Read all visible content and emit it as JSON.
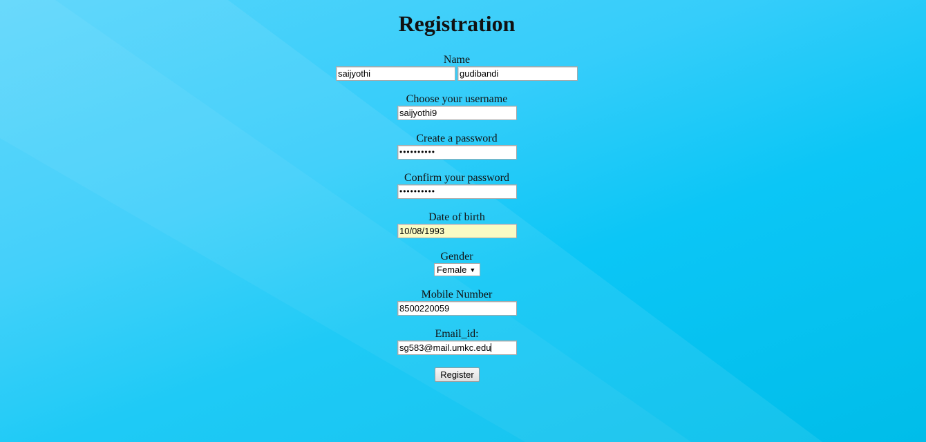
{
  "form": {
    "title": "Registration",
    "name": {
      "label": "Name",
      "first_value": "saijyothi",
      "last_value": "gudibandi"
    },
    "username": {
      "label": "Choose your username",
      "value": "saijyothi9"
    },
    "password": {
      "label": "Create a password",
      "masked_value": "••••••••••"
    },
    "confirm_password": {
      "label": "Confirm your password",
      "masked_value": "••••••••••"
    },
    "dob": {
      "label": "Date of birth",
      "value": "10/08/1993"
    },
    "gender": {
      "label": "Gender",
      "selected": "Female"
    },
    "mobile": {
      "label": "Mobile Number",
      "value": "8500220059"
    },
    "email": {
      "label": "Email_id:",
      "value": "sg583@mail.umkc.edu"
    },
    "register_label": "Register"
  },
  "theme": {
    "background": "#0bc6f6",
    "autofill": "#fafbc4"
  }
}
